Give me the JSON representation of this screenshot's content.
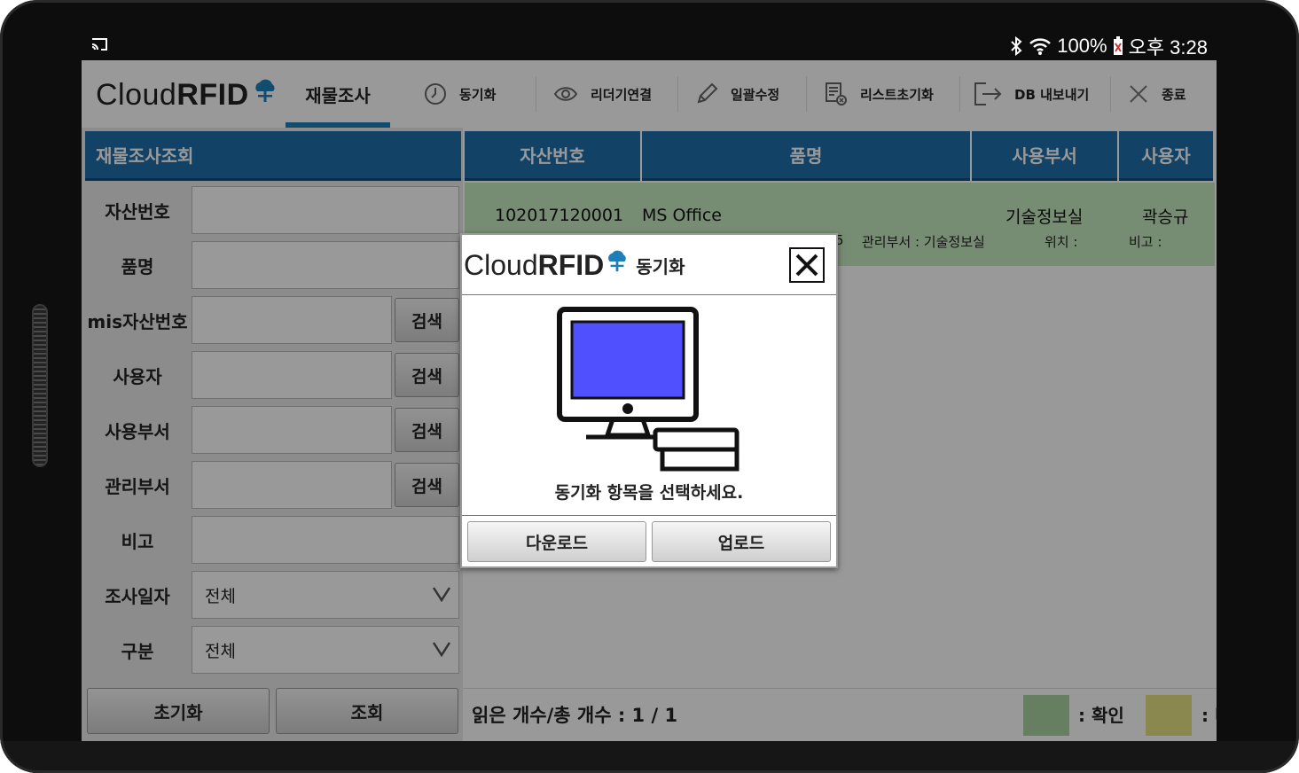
{
  "status_bar": {
    "battery": "100%",
    "clock": "오후 3:28",
    "icons": [
      "cast-icon",
      "bluetooth-icon",
      "wifi-icon",
      "battery-icon"
    ]
  },
  "app": {
    "brand_regular": "Cloud",
    "brand_bold": "RFID",
    "main_tab": "재물조사",
    "toolbar": [
      {
        "label": "동기화",
        "icon": "sync-clock-icon"
      },
      {
        "label": "리더기연결",
        "icon": "eye-icon"
      },
      {
        "label": "일괄수정",
        "icon": "pencil-icon"
      },
      {
        "label": "리스트초기화",
        "icon": "list-clear-icon"
      },
      {
        "label": "DB 내보내기",
        "icon": "export-icon"
      },
      {
        "label": "종료",
        "icon": "close-icon"
      }
    ]
  },
  "search_panel": {
    "title": "재물조사조회",
    "fields": [
      {
        "label": "자산번호",
        "value": ""
      },
      {
        "label": "품명",
        "value": ""
      },
      {
        "label": "mis자산번호",
        "value": "",
        "button": "검색"
      },
      {
        "label": "사용자",
        "value": "",
        "button": "검색"
      },
      {
        "label": "사용부서",
        "value": "",
        "button": "검색"
      },
      {
        "label": "관리부서",
        "value": "",
        "button": "검색"
      },
      {
        "label": "비고",
        "value": ""
      },
      {
        "label": "조사일자",
        "value": "전체"
      },
      {
        "label": "구분",
        "value": "전체"
      }
    ],
    "reset_button": "초기화",
    "query_button": "조회"
  },
  "result_table": {
    "columns": [
      "자산번호",
      "품명",
      "사용부서",
      "사용자"
    ],
    "rows": [
      {
        "asset_no": "102017120001",
        "item_name": "MS Office",
        "dept": "기술정보실",
        "user": "곽승규",
        "fragment": "5",
        "mgmt_dept": "관리부서 : 기술정보실",
        "location": "위치 :",
        "note": "비고 :"
      }
    ],
    "count_label": "읽은 개수/총 개수 : 1 / 1",
    "legend": [
      {
        "label": ":  확인",
        "color": "#a9d4a1"
      },
      {
        "label": ": 비고 수정",
        "color": "#e6e383"
      }
    ]
  },
  "dialog": {
    "brand_regular": "Cloud",
    "brand_bold": "RFID",
    "title": "동기화",
    "message": "동기화 항목을 선택하세요.",
    "download_button": "다운로드",
    "upload_button": "업로드",
    "screen_color": "#5050ff"
  }
}
